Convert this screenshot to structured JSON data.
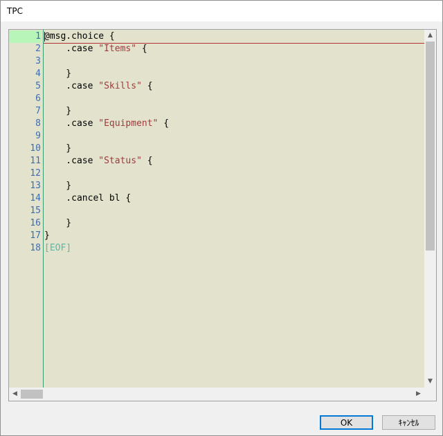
{
  "window": {
    "title": "TPC"
  },
  "editor": {
    "line_numbers": [
      "1",
      "2",
      "3",
      "4",
      "5",
      "6",
      "7",
      "8",
      "9",
      "10",
      "11",
      "12",
      "13",
      "14",
      "15",
      "16",
      "17",
      "18"
    ],
    "lines": [
      {
        "parts": [
          {
            "t": "@msg.choice {",
            "c": "plain"
          }
        ]
      },
      {
        "parts": [
          {
            "t": "    .case ",
            "c": "plain"
          },
          {
            "t": "\"Items\"",
            "c": "str"
          },
          {
            "t": " {",
            "c": "plain"
          }
        ]
      },
      {
        "parts": []
      },
      {
        "parts": [
          {
            "t": "    }",
            "c": "plain"
          }
        ]
      },
      {
        "parts": [
          {
            "t": "    .case ",
            "c": "plain"
          },
          {
            "t": "\"Skills\"",
            "c": "str"
          },
          {
            "t": " {",
            "c": "plain"
          }
        ]
      },
      {
        "parts": []
      },
      {
        "parts": [
          {
            "t": "    }",
            "c": "plain"
          }
        ]
      },
      {
        "parts": [
          {
            "t": "    .case ",
            "c": "plain"
          },
          {
            "t": "\"Equipment\"",
            "c": "str"
          },
          {
            "t": " {",
            "c": "plain"
          }
        ]
      },
      {
        "parts": []
      },
      {
        "parts": [
          {
            "t": "    }",
            "c": "plain"
          }
        ]
      },
      {
        "parts": [
          {
            "t": "    .case ",
            "c": "plain"
          },
          {
            "t": "\"Status\"",
            "c": "str"
          },
          {
            "t": " {",
            "c": "plain"
          }
        ]
      },
      {
        "parts": []
      },
      {
        "parts": [
          {
            "t": "    }",
            "c": "plain"
          }
        ]
      },
      {
        "parts": [
          {
            "t": "    .cancel bl {",
            "c": "plain"
          }
        ]
      },
      {
        "parts": []
      },
      {
        "parts": [
          {
            "t": "    }",
            "c": "plain"
          }
        ]
      },
      {
        "parts": [
          {
            "t": "}",
            "c": "plain"
          }
        ]
      },
      {
        "parts": [
          {
            "t": "[EOF]",
            "c": "eof"
          }
        ]
      }
    ],
    "current_line": 1,
    "colors": {
      "background": "#e3e3cd",
      "string": "#a03a3a",
      "eof": "#58b8a8",
      "line_number": "#3b6db3",
      "current_line_bg": "#b8f5b8"
    }
  },
  "buttons": {
    "ok_label": "OK",
    "cancel_label": "ｷｬﾝｾﾙ"
  },
  "icons": {
    "scroll_up": "▲",
    "scroll_down": "▼",
    "scroll_left": "◀",
    "scroll_right": "▶"
  }
}
